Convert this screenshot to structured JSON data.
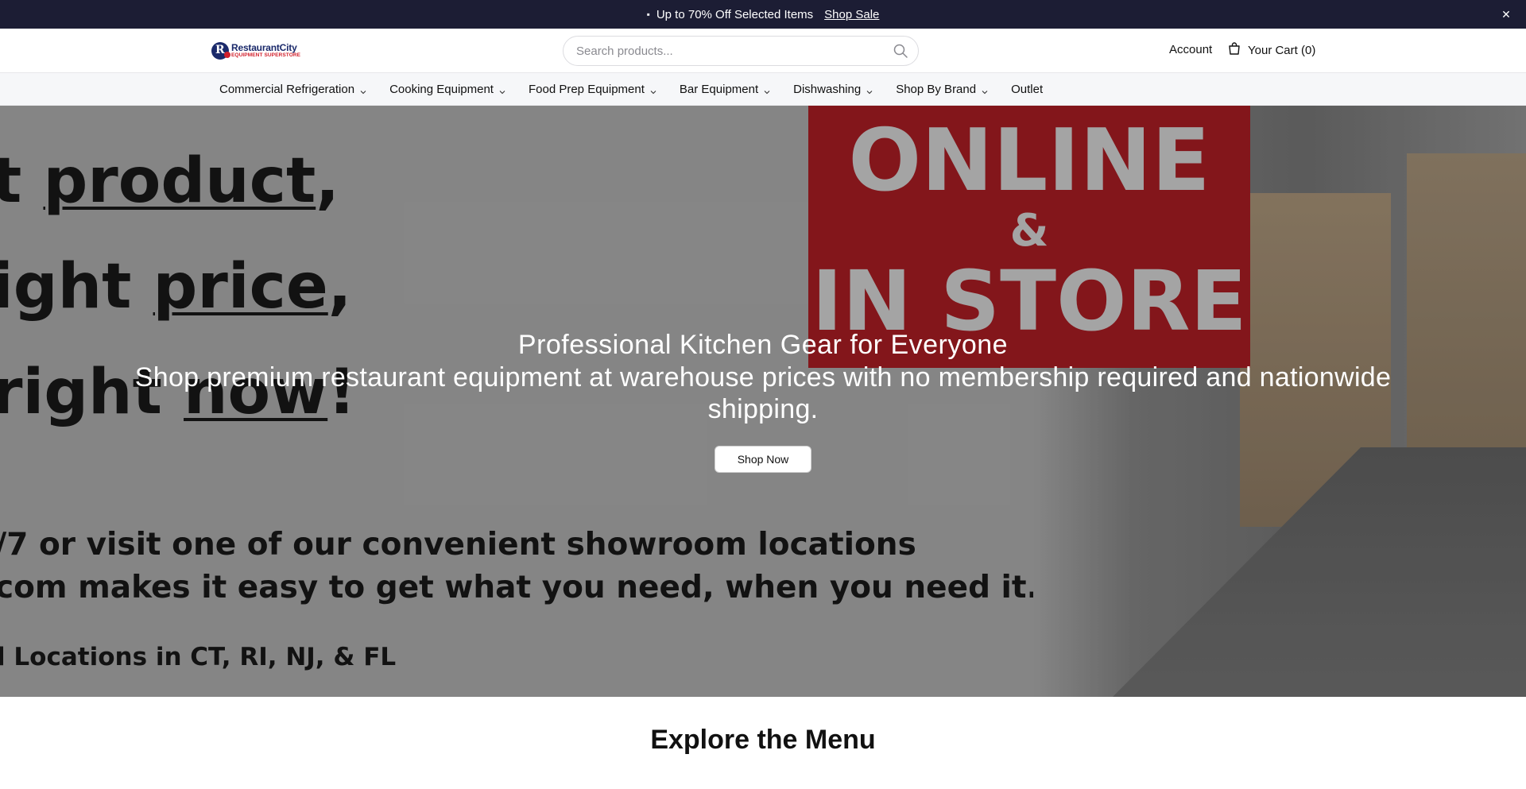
{
  "announcement": {
    "icon": "gift-icon",
    "message": "Up to 70% Off Selected Items",
    "link_label": "Shop Sale"
  },
  "header": {
    "logo": {
      "line1": "RestaurantCity",
      "line2": "EQUIPMENT SUPERSTORE"
    },
    "search": {
      "placeholder": "Search products...",
      "value": ""
    },
    "account_label": "Account",
    "cart_label": "Your Cart (0)"
  },
  "nav": {
    "items": [
      {
        "label": "Commercial Refrigeration",
        "has_dropdown": true
      },
      {
        "label": "Cooking Equipment",
        "has_dropdown": true
      },
      {
        "label": "Food Prep Equipment",
        "has_dropdown": true
      },
      {
        "label": "Bar Equipment",
        "has_dropdown": true
      },
      {
        "label": "Dishwashing",
        "has_dropdown": true
      },
      {
        "label": "Shop By Brand",
        "has_dropdown": true
      },
      {
        "label": "Outlet",
        "has_dropdown": false
      }
    ]
  },
  "hero": {
    "poster": {
      "line1": "t product,",
      "line2": "ight price,",
      "line3": "right now!",
      "line4": "/7 or visit one of our convenient showroom locations",
      "line5": "com makes it easy to get what you need, when you need it.",
      "line6": "l Locations in CT, RI, NJ, & FL",
      "sign_line1": "ONLINE",
      "sign_line2": "&",
      "sign_line3": "IN STORE"
    },
    "title": "Professional Kitchen Gear for Everyone",
    "subtitle": "Shop premium restaurant equipment at warehouse prices with no membership required and nationwide shipping.",
    "cta_label": "Shop Now"
  },
  "explore": {
    "title": "Explore the Menu"
  },
  "colors": {
    "announcement_bg": "#1c1d34",
    "brand_navy": "#1b2a6b",
    "brand_red": "#d11f2b",
    "sign_red": "#a01c22"
  }
}
